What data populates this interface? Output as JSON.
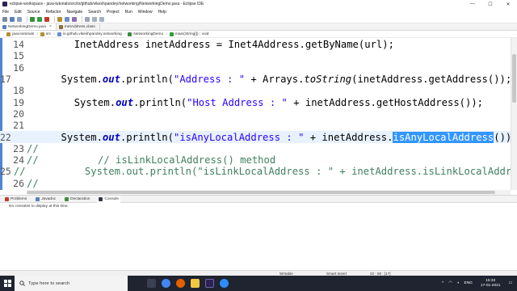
{
  "window": {
    "title": "eclipse-workspace - java-tutorials/src/io/github/vikeshpandey/networking/NetworkingDemo.java - Eclipse IDE",
    "minimize": "—",
    "maximize": "☐",
    "close": "✕"
  },
  "menu": [
    "File",
    "Edit",
    "Source",
    "Refactor",
    "Navigate",
    "Search",
    "Project",
    "Run",
    "Window",
    "Help"
  ],
  "tabs": [
    {
      "label": "NetworkingDemo.java",
      "close": "×"
    },
    {
      "label": "InetAddress.class",
      "close": ""
    }
  ],
  "breadcrumb": [
    "java-tutorials",
    "src",
    "io.github.vikeshpandey.networking",
    "NetworkingDemo",
    "main(String[]) : void"
  ],
  "editor": {
    "lines": [
      {
        "num": "14",
        "code": "        InetAddress inetAddress = Inet4Address.getByName(url);"
      },
      {
        "num": "15",
        "code": ""
      },
      {
        "num": "16",
        "code": ""
      },
      {
        "num": "17",
        "code_pre": "        System.",
        "field": "out",
        "code_post": ".println(",
        "string": "\"Address : \"",
        "code_tail": " + Arrays.",
        "method": "toString",
        "code_end": "(inetAddress.getAddress());"
      },
      {
        "num": "18",
        "code": ""
      },
      {
        "num": "19",
        "code_pre": "        System.",
        "field": "out",
        "code_post": ".println(",
        "string": "\"Host Address : \"",
        "code_tail": " + inetAddress.getHostAddress());"
      },
      {
        "num": "20",
        "code": ""
      },
      {
        "num": "21",
        "code": ""
      },
      {
        "num": "22",
        "code_pre": "        System.",
        "field": "out",
        "code_post": ".println(",
        "string": "\"isAnyLocalAddress : \"",
        "code_tail": " + inetAddress.",
        "selected": "isAnyLocalAddress",
        "code_end": "());"
      },
      {
        "num": "23",
        "comment": "//"
      },
      {
        "num": "24",
        "comment": "//          // isLinkLocalAddress() method"
      },
      {
        "num": "25",
        "comment": "//          System.out.println(\"isLinkLocalAddress : \" + inetAddress.isLinkLocalAddress());"
      },
      {
        "num": "26",
        "comment": "//"
      }
    ]
  },
  "panel": {
    "tabs": [
      "Problems",
      "Javadoc",
      "Declaration",
      "Console"
    ],
    "message": "No consoles to display at this time."
  },
  "status": {
    "mode": "Writable",
    "insert": "Smart Insert",
    "position": "22 : 66 : [17]"
  },
  "taskbar": {
    "search_placeholder": "Type here to search",
    "lang": "ENG",
    "time": "15:33",
    "date": "17-01-2021"
  }
}
